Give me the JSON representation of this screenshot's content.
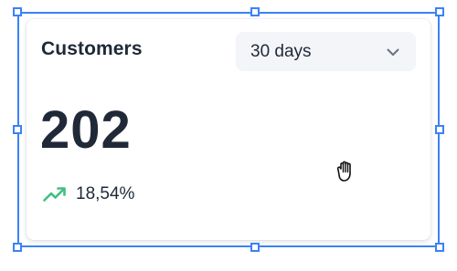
{
  "widget": {
    "title": "Customers",
    "date_range": {
      "selected": "30 days",
      "icon": "chevron-down-icon"
    },
    "metric_value": "202",
    "trend": {
      "icon": "trend-up-icon",
      "value": "18,54%",
      "color": "#3fbf7f"
    }
  },
  "selection": {
    "color": "#3b82f6"
  },
  "cursor": {
    "icon": "grab-hand-cursor-icon"
  }
}
